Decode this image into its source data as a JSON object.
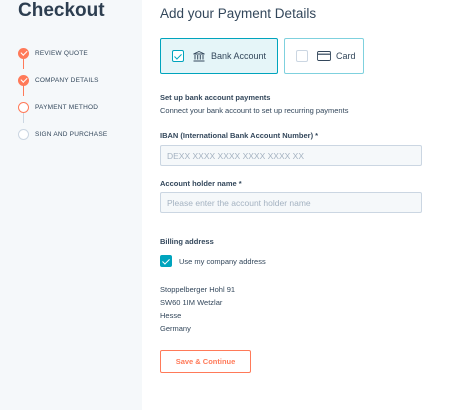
{
  "sidebar": {
    "title": "Checkout",
    "steps": [
      {
        "label": "REVIEW QUOTE",
        "state": "done"
      },
      {
        "label": "COMPANY DETAILS",
        "state": "done"
      },
      {
        "label": "PAYMENT METHOD",
        "state": "current"
      },
      {
        "label": "SIGN AND PURCHASE",
        "state": "todo"
      }
    ]
  },
  "main": {
    "title": "Add your Payment Details",
    "methods": [
      {
        "label": "Bank Account",
        "selected": true,
        "icon": "bank-icon"
      },
      {
        "label": "Card",
        "selected": false,
        "icon": "credit-card-icon"
      }
    ],
    "bank_section": {
      "heading": "Set up bank account payments",
      "description": "Connect your bank account to set up recurring payments"
    },
    "iban": {
      "label": "IBAN (International Bank Account Number) *",
      "value": "",
      "placeholder": "DEXX XXXX XXXX XXXX XXXX XX"
    },
    "holder": {
      "label": "Account holder name *",
      "value": "",
      "placeholder": "Please enter the account holder name"
    },
    "billing": {
      "label": "Billing address",
      "use_company_label": "Use my company address",
      "use_company_checked": true,
      "address_lines": [
        "Stoppelberger Hohl 91",
        "SW60 1IM Wetzlar",
        "Hesse",
        "Germany"
      ]
    },
    "submit_label": "Save & Continue"
  },
  "colors": {
    "accent": "#ff7a59",
    "selection": "#00a4bd",
    "text": "#33475b",
    "sidebar_bg": "#f5f8fa"
  }
}
